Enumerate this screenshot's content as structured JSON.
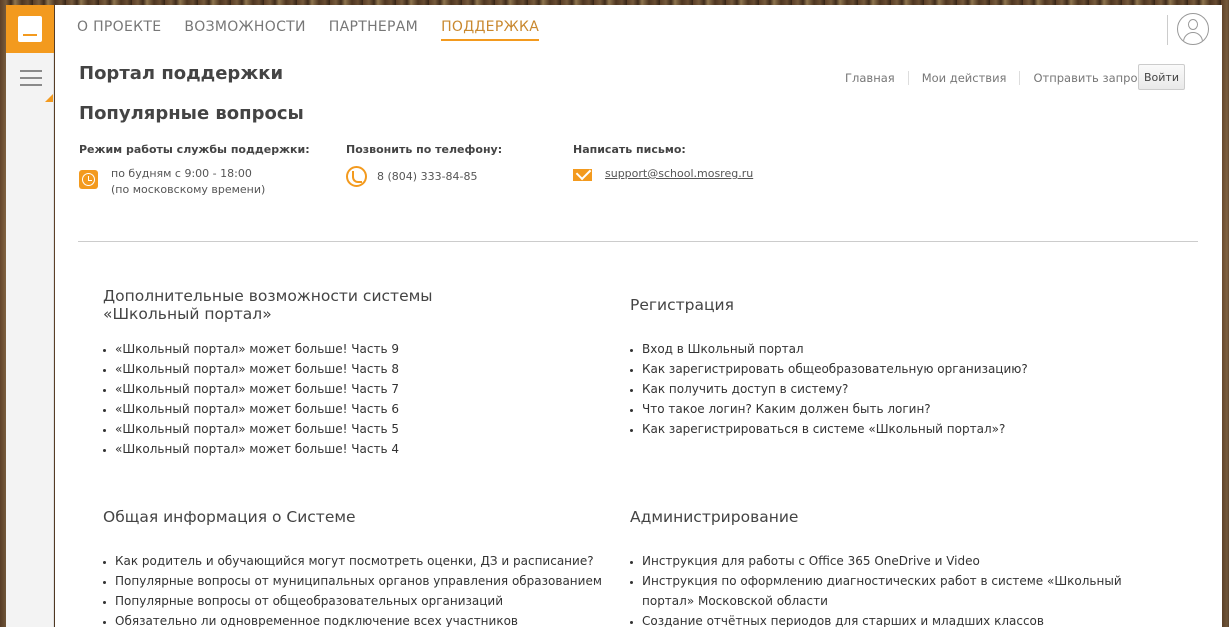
{
  "topnav": [
    {
      "label": "О ПРОЕКТЕ",
      "active": false
    },
    {
      "label": "ВОЗМОЖНОСТИ",
      "active": false
    },
    {
      "label": "ПАРТНЕРАМ",
      "active": false
    },
    {
      "label": "ПОДДЕРЖКА",
      "active": true
    }
  ],
  "header": {
    "page_title": "Портал поддержки",
    "subnav": [
      "Главная",
      "Мои действия",
      "Отправить запрос"
    ],
    "login_label": "Войти"
  },
  "section_title": "Популярные вопросы",
  "contacts": {
    "hours": {
      "title": "Режим работы службы поддержки:",
      "line1": "по будням с 9:00 - 18:00",
      "line2": "(по московскому времени)"
    },
    "phone": {
      "title": "Позвонить по телефону:",
      "value": "8 (804) 333-84-85"
    },
    "mail": {
      "title": "Написать письмо:",
      "value": "support@school.mosreg.ru"
    }
  },
  "blocks": [
    {
      "title_line1": "Дополнительные возможности системы",
      "title_line2": "«Школьный портал»",
      "items": [
        "«Школьный портал» может больше! Часть 9",
        "«Школьный портал» может больше! Часть 8",
        "«Школьный портал» может больше! Часть 7",
        "«Школьный портал» может больше! Часть 6",
        "«Школьный портал» может больше! Часть 5",
        "«Школьный портал» может больше! Часть 4"
      ]
    },
    {
      "title_line1": "Регистрация",
      "items": [
        "Вход в Школьный портал",
        "Как зарегистрировать общеобразовательную организацию?",
        "Как получить доступ в систему?",
        "Что такое логин? Каким должен быть логин?",
        "Как зарегистрироваться в системе «Школьный портал»?"
      ]
    },
    {
      "title_line1": "Общая информация о Системе",
      "items": [
        "Как родитель и обучающийся могут посмотреть оценки, ДЗ и расписание?",
        "Популярные вопросы от муниципальных органов управления образованием",
        "Популярные вопросы от общеобразовательных организаций",
        "Обязательно ли одновременное подключение всех участников образовательного"
      ]
    },
    {
      "title_line1": "Администрирование",
      "items": [
        "Инструкция для работы с Office 365 OneDrive и Video",
        "Инструкция по оформлению диагностических работ в системе «Школьный портал» Московской области",
        "Создание отчётных периодов для старших и младших классов"
      ]
    }
  ],
  "colors": {
    "accent": "#f39a1e",
    "sidebar": "#f3f3f3"
  },
  "icons": [
    "book-logo-icon",
    "menu-icon",
    "user-icon",
    "clock-icon",
    "phone-icon",
    "mail-icon"
  ]
}
